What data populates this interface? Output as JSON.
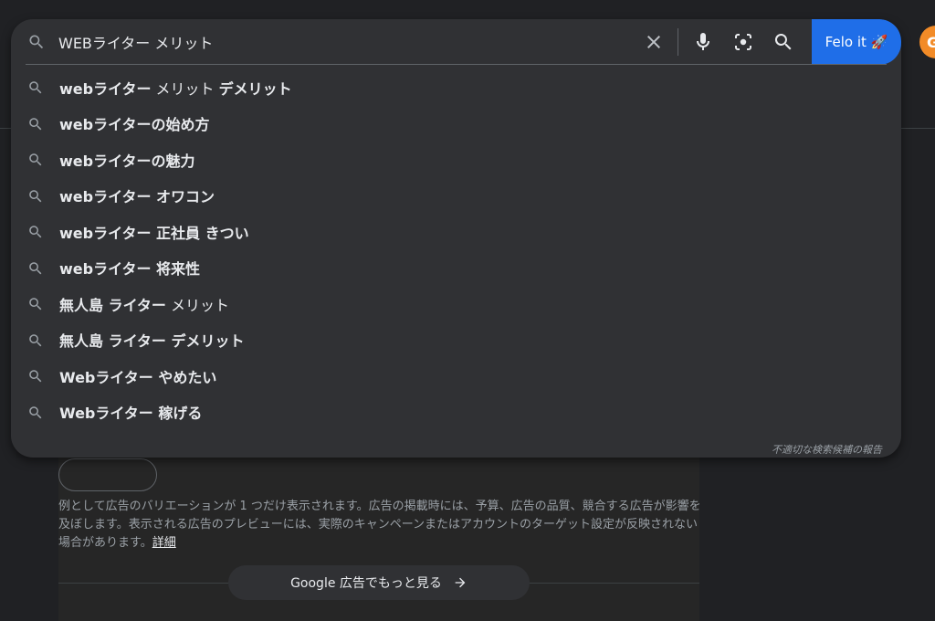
{
  "search": {
    "query": "WEBライター メリット",
    "felo_label": "Felo it 🚀"
  },
  "suggestions": [
    {
      "prefix": "webライター",
      "middle": " メリット ",
      "suffix": "デメリット"
    },
    {
      "prefix": "webライターの始め方",
      "middle": "",
      "suffix": ""
    },
    {
      "prefix": "webライターの魅力",
      "middle": "",
      "suffix": ""
    },
    {
      "prefix": "webライター オワコン",
      "middle": "",
      "suffix": ""
    },
    {
      "prefix": "webライター 正社員 きつい",
      "middle": "",
      "suffix": ""
    },
    {
      "prefix": "webライター 将来性",
      "middle": "",
      "suffix": ""
    },
    {
      "prefix": "無人島 ライター",
      "middle": " メリット",
      "suffix": ""
    },
    {
      "prefix": "無人島 ライター デメリット",
      "middle": "",
      "suffix": ""
    },
    {
      "prefix": "Webライター やめたい",
      "middle": "",
      "suffix": ""
    },
    {
      "prefix": "Webライター 稼げる",
      "middle": "",
      "suffix": ""
    }
  ],
  "report_label": "不適切な検索候補の報告",
  "ad_note": {
    "text": "例として広告のバリエーションが 1 つだけ表示されます。広告の掲載時には、予算、広告の品質、競合する広告が影響を及ぼします。表示される広告のプレビューには、実際のキャンペーンまたはアカウントのターゲット設定が反映されない場合があります。",
    "link": "詳細"
  },
  "more_ads_label": "Google 広告でもっと見る",
  "avatar_letter": "G",
  "colors": {
    "accent": "#1f6ee8",
    "avatar": "#f28b27",
    "panel": "#303134",
    "background": "#202124"
  }
}
